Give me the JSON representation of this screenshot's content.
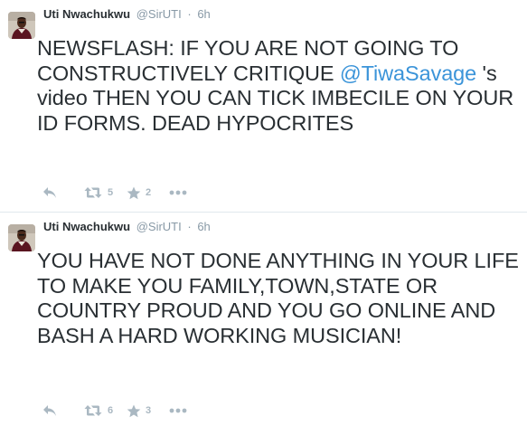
{
  "tweets": [
    {
      "author": {
        "name": "Uti Nwachukwu",
        "handle": "@SirUTI"
      },
      "separator": "·",
      "time": "6h",
      "text_part1": "NEWSFLASH: IF YOU ARE NOT GOING TO CONSTRUCTIVELY CRITIQUE ",
      "mention": "@TiwaSavage",
      "text_part2": " 's video THEN YOU CAN TICK IMBECILE ON YOUR ID FORMS. DEAD HYPOCRITES",
      "retweets": "5",
      "favorites": "2",
      "icons": [
        "reply-icon",
        "retweet-icon",
        "favorite-icon",
        "more-icon"
      ]
    },
    {
      "author": {
        "name": "Uti Nwachukwu",
        "handle": "@SirUTI"
      },
      "separator": "·",
      "time": "6h",
      "text": "YOU HAVE NOT DONE ANYTHING IN YOUR LIFE TO MAKE YOU FAMILY,TOWN,STATE OR COUNTRY PROUD AND YOU GO ONLINE AND BASH A HARD WORKING MUSICIAN!",
      "retweets": "6",
      "favorites": "3",
      "icons": [
        "reply-icon",
        "retweet-icon",
        "favorite-icon",
        "more-icon"
      ]
    }
  ],
  "colors": {
    "text": "#292f33",
    "muted": "#8899a6",
    "mention": "#3b94d9",
    "action_icon": "#aab8c2",
    "divider": "#e1e8ed"
  }
}
